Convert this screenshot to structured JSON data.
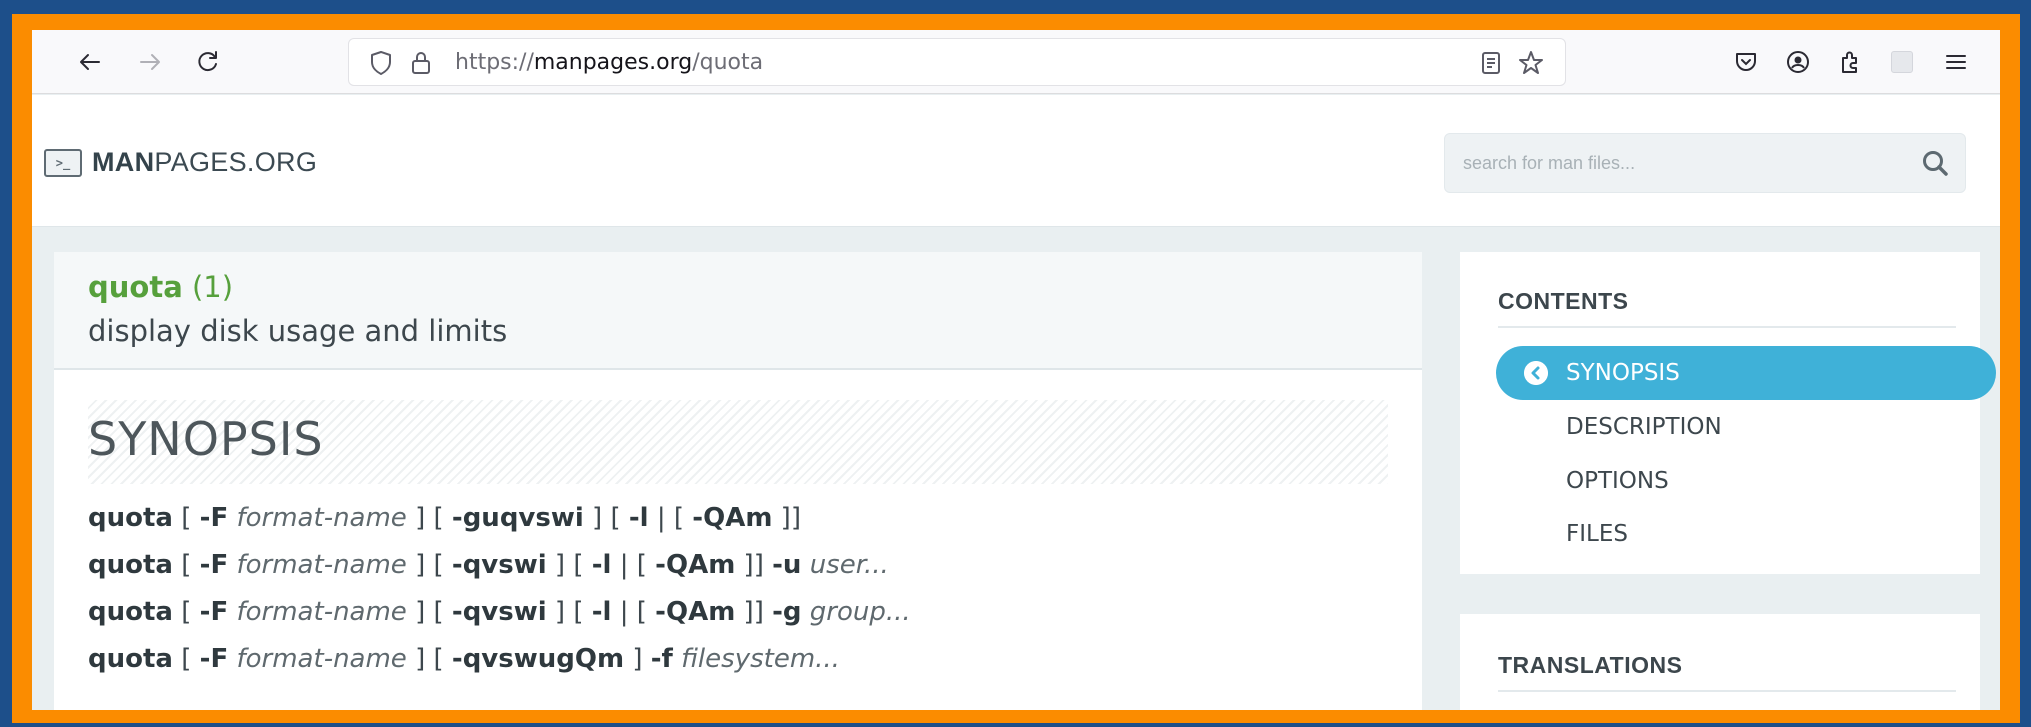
{
  "browser": {
    "url_scheme": "https://",
    "url_host": "manpages.org",
    "url_path": "/quota"
  },
  "site": {
    "logo_bold": "MAN",
    "logo_rest": "PAGES.ORG",
    "search_placeholder": "search for man files..."
  },
  "page": {
    "command": "quota",
    "section": "(1)",
    "description": "display disk usage and limits",
    "section_heading": "SYNOPSIS",
    "synopsis": [
      [
        {
          "t": "b",
          "v": "quota"
        },
        {
          "t": "n",
          "v": " [ "
        },
        {
          "t": "b",
          "v": "-F"
        },
        {
          "t": "n",
          "v": " "
        },
        {
          "t": "i",
          "v": "format-name"
        },
        {
          "t": "n",
          "v": " ] [ "
        },
        {
          "t": "b",
          "v": "-guqvswi"
        },
        {
          "t": "n",
          "v": " ] [ "
        },
        {
          "t": "b",
          "v": "-l"
        },
        {
          "t": "n",
          "v": " | [ "
        },
        {
          "t": "b",
          "v": "-QAm"
        },
        {
          "t": "n",
          "v": " ]]"
        }
      ],
      [
        {
          "t": "b",
          "v": "quota"
        },
        {
          "t": "n",
          "v": " [ "
        },
        {
          "t": "b",
          "v": "-F"
        },
        {
          "t": "n",
          "v": " "
        },
        {
          "t": "i",
          "v": "format-name"
        },
        {
          "t": "n",
          "v": " ] [ "
        },
        {
          "t": "b",
          "v": "-qvswi"
        },
        {
          "t": "n",
          "v": " ] [ "
        },
        {
          "t": "b",
          "v": "-l"
        },
        {
          "t": "n",
          "v": " | [ "
        },
        {
          "t": "b",
          "v": "-QAm"
        },
        {
          "t": "n",
          "v": " ]] "
        },
        {
          "t": "b",
          "v": "-u"
        },
        {
          "t": "n",
          "v": " "
        },
        {
          "t": "i",
          "v": "user..."
        }
      ],
      [
        {
          "t": "b",
          "v": "quota"
        },
        {
          "t": "n",
          "v": " [ "
        },
        {
          "t": "b",
          "v": "-F"
        },
        {
          "t": "n",
          "v": " "
        },
        {
          "t": "i",
          "v": "format-name"
        },
        {
          "t": "n",
          "v": " ] [ "
        },
        {
          "t": "b",
          "v": "-qvswi"
        },
        {
          "t": "n",
          "v": " ] [ "
        },
        {
          "t": "b",
          "v": "-l"
        },
        {
          "t": "n",
          "v": " | [ "
        },
        {
          "t": "b",
          "v": "-QAm"
        },
        {
          "t": "n",
          "v": " ]] "
        },
        {
          "t": "b",
          "v": "-g"
        },
        {
          "t": "n",
          "v": " "
        },
        {
          "t": "i",
          "v": "group..."
        }
      ],
      [
        {
          "t": "b",
          "v": "quota"
        },
        {
          "t": "n",
          "v": " [ "
        },
        {
          "t": "b",
          "v": "-F"
        },
        {
          "t": "n",
          "v": " "
        },
        {
          "t": "i",
          "v": "format-name"
        },
        {
          "t": "n",
          "v": " ] [ "
        },
        {
          "t": "b",
          "v": "-qvswugQm"
        },
        {
          "t": "n",
          "v": " ] "
        },
        {
          "t": "b",
          "v": "-f"
        },
        {
          "t": "n",
          "v": " "
        },
        {
          "t": "i",
          "v": "filesystem..."
        }
      ]
    ]
  },
  "contents": {
    "title": "CONTENTS",
    "items": [
      {
        "label": "SYNOPSIS",
        "active": true
      },
      {
        "label": "DESCRIPTION",
        "active": false
      },
      {
        "label": "OPTIONS",
        "active": false
      },
      {
        "label": "FILES",
        "active": false
      }
    ]
  },
  "translations": {
    "title": "TRANSLATIONS"
  },
  "colors": {
    "accent": "#3fb1d8",
    "command_green": "#56a03c",
    "frame_orange": "#fb8c00"
  }
}
